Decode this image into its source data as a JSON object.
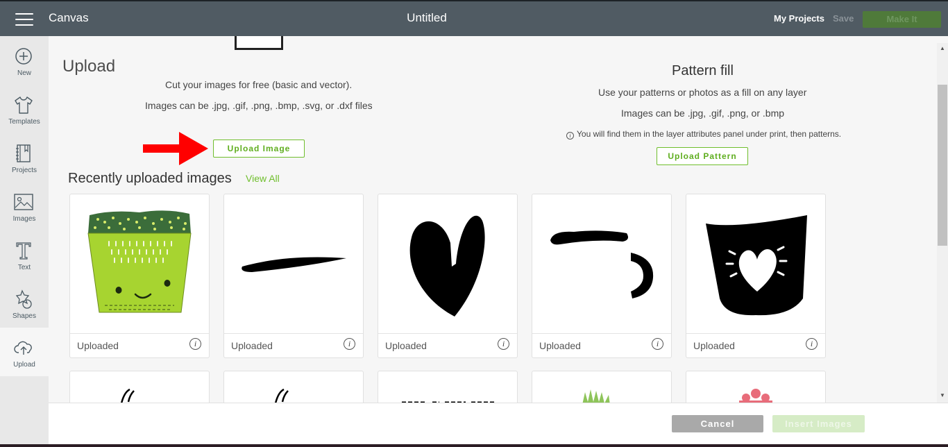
{
  "header": {
    "app_title": "Canvas",
    "document_title": "Untitled",
    "my_projects_label": "My Projects",
    "save_label": "Save",
    "make_it_label": "Make It"
  },
  "sidebar": {
    "items": [
      {
        "label": "New",
        "icon": "plus-circle-icon"
      },
      {
        "label": "Templates",
        "icon": "tshirt-icon"
      },
      {
        "label": "Projects",
        "icon": "notebook-icon"
      },
      {
        "label": "Images",
        "icon": "image-icon"
      },
      {
        "label": "Text",
        "icon": "text-icon"
      },
      {
        "label": "Shapes",
        "icon": "shapes-icon"
      },
      {
        "label": "Upload",
        "icon": "cloud-upload-icon",
        "active": true
      }
    ]
  },
  "upload": {
    "heading": "Upload",
    "description_line1": "Cut your images for free (basic and vector).",
    "description_line2": "Images can be .jpg, .gif, .png, .bmp, .svg, or .dxf files",
    "button_label": "Upload Image"
  },
  "pattern_fill": {
    "heading": "Pattern fill",
    "description_line1": "Use your patterns or photos as a fill on any layer",
    "description_line2": "Images can be .jpg, .gif, .png, or .bmp",
    "note": "You will find them in the layer attributes panel under print, then patterns.",
    "note_icon": "i",
    "button_label": "Upload Pattern"
  },
  "recent": {
    "heading": "Recently uploaded images",
    "view_all_label": "View All",
    "cards": [
      {
        "caption": "Uploaded",
        "info": "i",
        "image": "green-pot-face"
      },
      {
        "caption": "Uploaded",
        "info": "i",
        "image": "black-stroke"
      },
      {
        "caption": "Uploaded",
        "info": "i",
        "image": "black-heart"
      },
      {
        "caption": "Uploaded",
        "info": "i",
        "image": "mug-outline-pieces"
      },
      {
        "caption": "Uploaded",
        "info": "i",
        "image": "black-pot-heart"
      }
    ]
  },
  "footer": {
    "cancel_label": "Cancel",
    "insert_label": "Insert Images"
  },
  "colors": {
    "topbar": "#505b63",
    "accent_green": "#6fbe2c",
    "make_it_bg": "#4f7a3a",
    "arrow_red": "#ff0000"
  }
}
